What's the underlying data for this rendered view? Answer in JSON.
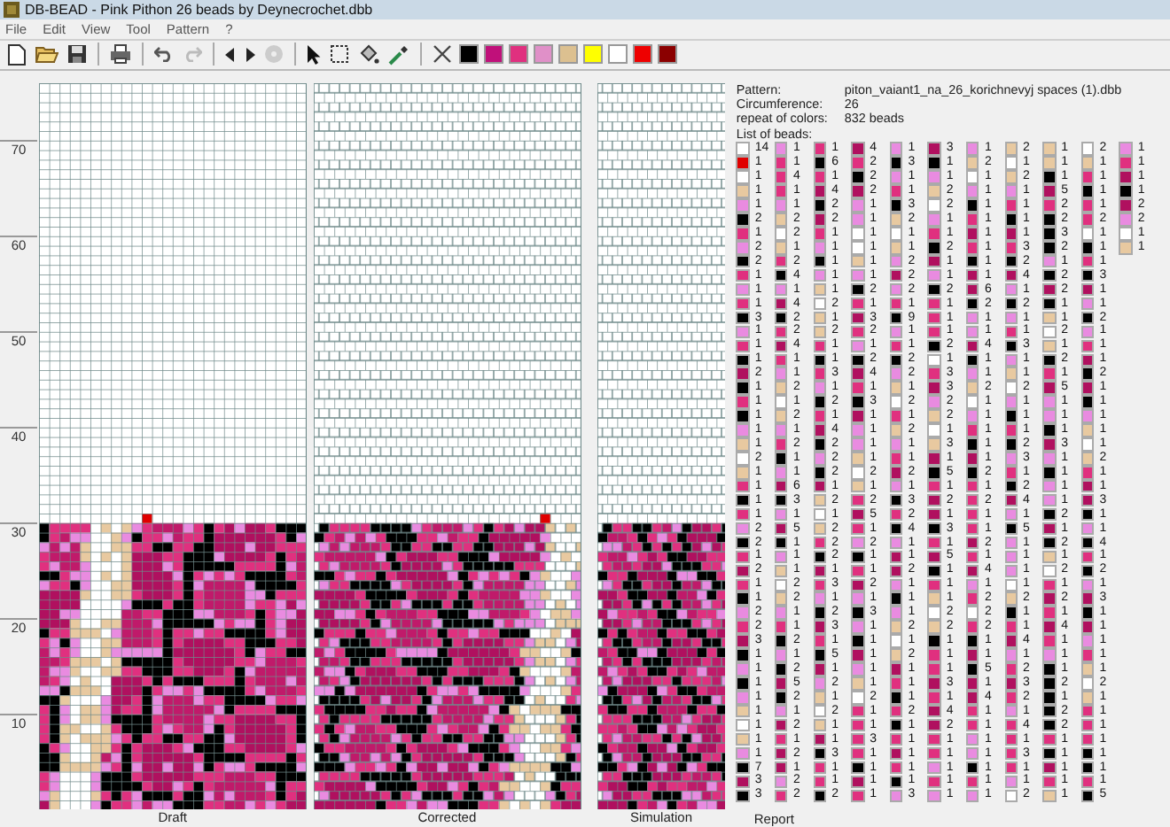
{
  "window": {
    "title": "DB-BEAD - Pink Pithon 26 beads by Deynecrochet.dbb"
  },
  "menu": [
    {
      "label": "File"
    },
    {
      "label": "Edit"
    },
    {
      "label": "View"
    },
    {
      "label": "Tool"
    },
    {
      "label": "Pattern"
    },
    {
      "label": "?"
    }
  ],
  "palette": [
    {
      "color": "#000000"
    },
    {
      "color": "#c0107a"
    },
    {
      "color": "#e0307f"
    },
    {
      "color": "#e090c8"
    },
    {
      "color": "#dcc090"
    },
    {
      "color": "#ffff00"
    },
    {
      "color": "#ffffff"
    },
    {
      "color": "#ee0000"
    },
    {
      "color": "#8b0000"
    }
  ],
  "ruler": [
    "70",
    "60",
    "50",
    "40",
    "30",
    "20",
    "10"
  ],
  "panels": [
    {
      "label": "Draft",
      "kind": "draft"
    },
    {
      "label": "Corrected",
      "kind": "corrected"
    },
    {
      "label": "Simulation",
      "kind": "simulation"
    }
  ],
  "report": {
    "label": "Report",
    "fields": [
      {
        "label": "Pattern:",
        "value": "piton_vaiant1_na_26_korichnevyj spaces (1).dbb"
      },
      {
        "label": "Circumference:",
        "value": "26"
      },
      {
        "label": "repeat of colors:",
        "value": "832 beads"
      }
    ],
    "list_title": "List of beads:",
    "rows": [
      [
        {
          "color": "#ffffff",
          "count": "14"
        },
        {
          "color": "#e98be0",
          "count": "1"
        },
        {
          "color": "#e0307f",
          "count": "1"
        },
        {
          "color": "#b0105f",
          "count": "4"
        },
        {
          "color": "#e98be0",
          "count": "1"
        },
        {
          "color": "#b0105f",
          "count": "3"
        },
        {
          "color": "#e98be0",
          "count": "1"
        },
        {
          "color": "#e8c9a0",
          "count": "2"
        },
        {
          "color": "#e8c9a0",
          "count": "1"
        },
        {
          "color": "#ffffff",
          "count": "2"
        },
        {
          "color": "#e98be0",
          "count": "1"
        }
      ],
      [
        {
          "color": "#e00000",
          "count": "1"
        },
        {
          "color": "#e0307f",
          "count": "1"
        },
        {
          "color": "#000000",
          "count": "6"
        },
        {
          "color": "#e0307f",
          "count": "2"
        },
        {
          "color": "#000000",
          "count": "3"
        },
        {
          "color": "#000000",
          "count": "1"
        },
        {
          "color": "#e8c9a0",
          "count": "2"
        },
        {
          "color": "#ffffff",
          "count": "1"
        },
        {
          "color": "#e8c9a0",
          "count": "1"
        },
        {
          "color": "#e8c9a0",
          "count": "1"
        },
        {
          "color": "#e0307f",
          "count": "1"
        }
      ],
      [
        {
          "color": "#ffffff",
          "count": "1"
        },
        {
          "color": "#e0307f",
          "count": "4"
        },
        {
          "color": "#e0307f",
          "count": "1"
        },
        {
          "color": "#000000",
          "count": "2"
        },
        {
          "color": "#e98be0",
          "count": "1"
        },
        {
          "color": "#e98be0",
          "count": "1"
        },
        {
          "color": "#ffffff",
          "count": "1"
        },
        {
          "color": "#e8c9a0",
          "count": "2"
        },
        {
          "color": "#000000",
          "count": "1"
        },
        {
          "color": "#e0307f",
          "count": "1"
        },
        {
          "color": "#b0105f",
          "count": "1"
        }
      ],
      [
        {
          "color": "#e8c9a0",
          "count": "1"
        },
        {
          "color": "#e0307f",
          "count": "1"
        },
        {
          "color": "#b0105f",
          "count": "4"
        },
        {
          "color": "#b0105f",
          "count": "2"
        },
        {
          "color": "#e0307f",
          "count": "1"
        },
        {
          "color": "#e8c9a0",
          "count": "2"
        },
        {
          "color": "#e98be0",
          "count": "1"
        },
        {
          "color": "#e98be0",
          "count": "1"
        },
        {
          "color": "#b0105f",
          "count": "5"
        },
        {
          "color": "#000000",
          "count": "1"
        },
        {
          "color": "#000000",
          "count": "1"
        }
      ],
      [
        {
          "color": "#e98be0",
          "count": "1"
        },
        {
          "color": "#e98be0",
          "count": "1"
        },
        {
          "color": "#000000",
          "count": "2"
        },
        {
          "color": "#e98be0",
          "count": "1"
        },
        {
          "color": "#000000",
          "count": "3"
        },
        {
          "color": "#ffffff",
          "count": "2"
        },
        {
          "color": "#000000",
          "count": "1"
        },
        {
          "color": "#e0307f",
          "count": "1"
        },
        {
          "color": "#e0307f",
          "count": "2"
        },
        {
          "color": "#e0307f",
          "count": "1"
        },
        {
          "color": "#b0105f",
          "count": "2"
        }
      ],
      [
        {
          "color": "#000000",
          "count": "2"
        },
        {
          "color": "#e8c9a0",
          "count": "2"
        },
        {
          "color": "#b0105f",
          "count": "2"
        },
        {
          "color": "#e98be0",
          "count": "1"
        },
        {
          "color": "#e8c9a0",
          "count": "2"
        },
        {
          "color": "#e98be0",
          "count": "1"
        },
        {
          "color": "#e0307f",
          "count": "1"
        },
        {
          "color": "#000000",
          "count": "1"
        },
        {
          "color": "#000000",
          "count": "2"
        },
        {
          "color": "#e0307f",
          "count": "2"
        },
        {
          "color": "#e98be0",
          "count": "2"
        }
      ],
      [
        {
          "color": "#e0307f",
          "count": "1"
        },
        {
          "color": "#ffffff",
          "count": "2"
        },
        {
          "color": "#e0307f",
          "count": "1"
        },
        {
          "color": "#ffffff",
          "count": "1"
        },
        {
          "color": "#ffffff",
          "count": "1"
        },
        {
          "color": "#e0307f",
          "count": "1"
        },
        {
          "color": "#b0105f",
          "count": "1"
        },
        {
          "color": "#b0105f",
          "count": "1"
        },
        {
          "color": "#000000",
          "count": "3"
        },
        {
          "color": "#ffffff",
          "count": "1"
        },
        {
          "color": "#ffffff",
          "count": "1"
        }
      ],
      [
        {
          "color": "#e98be0",
          "count": "2"
        },
        {
          "color": "#e8c9a0",
          "count": "1"
        },
        {
          "color": "#e98be0",
          "count": "1"
        },
        {
          "color": "#ffffff",
          "count": "1"
        },
        {
          "color": "#e8c9a0",
          "count": "1"
        },
        {
          "color": "#000000",
          "count": "2"
        },
        {
          "color": "#e0307f",
          "count": "1"
        },
        {
          "color": "#e0307f",
          "count": "3"
        },
        {
          "color": "#000000",
          "count": "2"
        },
        {
          "color": "#000000",
          "count": "1"
        },
        {
          "color": "#e8c9a0",
          "count": "1"
        }
      ],
      [
        {
          "color": "#000000",
          "count": "2"
        },
        {
          "color": "#e0307f",
          "count": "2"
        },
        {
          "color": "#000000",
          "count": "1"
        },
        {
          "color": "#e8c9a0",
          "count": "1"
        },
        {
          "color": "#e98be0",
          "count": "2"
        },
        {
          "color": "#b0105f",
          "count": "1"
        },
        {
          "color": "#000000",
          "count": "1"
        },
        {
          "color": "#000000",
          "count": "2"
        },
        {
          "color": "#e98be0",
          "count": "1"
        },
        {
          "color": "#e0307f",
          "count": "1"
        }
      ],
      [
        {
          "color": "#e0307f",
          "count": "1"
        },
        {
          "color": "#000000",
          "count": "4"
        },
        {
          "color": "#e98be0",
          "count": "1"
        },
        {
          "color": "#e98be0",
          "count": "1"
        },
        {
          "color": "#b0105f",
          "count": "2"
        },
        {
          "color": "#e98be0",
          "count": "1"
        },
        {
          "color": "#b0105f",
          "count": "1"
        },
        {
          "color": "#b0105f",
          "count": "4"
        },
        {
          "color": "#000000",
          "count": "2"
        },
        {
          "color": "#000000",
          "count": "3"
        }
      ],
      [
        {
          "color": "#e98be0",
          "count": "1"
        },
        {
          "color": "#e98be0",
          "count": "1"
        },
        {
          "color": "#e8c9a0",
          "count": "1"
        },
        {
          "color": "#000000",
          "count": "2"
        },
        {
          "color": "#e98be0",
          "count": "2"
        },
        {
          "color": "#000000",
          "count": "2"
        },
        {
          "color": "#b0105f",
          "count": "6"
        },
        {
          "color": "#e98be0",
          "count": "1"
        },
        {
          "color": "#b0105f",
          "count": "2"
        },
        {
          "color": "#b0105f",
          "count": "1"
        }
      ],
      [
        {
          "color": "#e0307f",
          "count": "1"
        },
        {
          "color": "#b0105f",
          "count": "4"
        },
        {
          "color": "#ffffff",
          "count": "2"
        },
        {
          "color": "#e0307f",
          "count": "1"
        },
        {
          "color": "#e0307f",
          "count": "1"
        },
        {
          "color": "#e0307f",
          "count": "1"
        },
        {
          "color": "#000000",
          "count": "2"
        },
        {
          "color": "#000000",
          "count": "2"
        },
        {
          "color": "#000000",
          "count": "1"
        },
        {
          "color": "#e98be0",
          "count": "1"
        }
      ],
      [
        {
          "color": "#000000",
          "count": "3"
        },
        {
          "color": "#000000",
          "count": "2"
        },
        {
          "color": "#e8c9a0",
          "count": "1"
        },
        {
          "color": "#b0105f",
          "count": "3"
        },
        {
          "color": "#000000",
          "count": "9"
        },
        {
          "color": "#e0307f",
          "count": "1"
        },
        {
          "color": "#e98be0",
          "count": "1"
        },
        {
          "color": "#e98be0",
          "count": "1"
        },
        {
          "color": "#e8c9a0",
          "count": "1"
        },
        {
          "color": "#000000",
          "count": "2"
        }
      ],
      [
        {
          "color": "#e98be0",
          "count": "1"
        },
        {
          "color": "#e0307f",
          "count": "2"
        },
        {
          "color": "#e8c9a0",
          "count": "2"
        },
        {
          "color": "#e0307f",
          "count": "2"
        },
        {
          "color": "#e98be0",
          "count": "1"
        },
        {
          "color": "#e0307f",
          "count": "1"
        },
        {
          "color": "#e98be0",
          "count": "1"
        },
        {
          "color": "#e0307f",
          "count": "1"
        },
        {
          "color": "#ffffff",
          "count": "2"
        },
        {
          "color": "#e98be0",
          "count": "1"
        }
      ],
      [
        {
          "color": "#e0307f",
          "count": "1"
        },
        {
          "color": "#b0105f",
          "count": "4"
        },
        {
          "color": "#e0307f",
          "count": "1"
        },
        {
          "color": "#e98be0",
          "count": "1"
        },
        {
          "color": "#e0307f",
          "count": "1"
        },
        {
          "color": "#000000",
          "count": "2"
        },
        {
          "color": "#b0105f",
          "count": "4"
        },
        {
          "color": "#000000",
          "count": "3"
        },
        {
          "color": "#e8c9a0",
          "count": "1"
        },
        {
          "color": "#e0307f",
          "count": "1"
        }
      ],
      [
        {
          "color": "#000000",
          "count": "1"
        },
        {
          "color": "#e0307f",
          "count": "1"
        },
        {
          "color": "#000000",
          "count": "1"
        },
        {
          "color": "#000000",
          "count": "2"
        },
        {
          "color": "#000000",
          "count": "2"
        },
        {
          "color": "#ffffff",
          "count": "1"
        },
        {
          "color": "#000000",
          "count": "1"
        },
        {
          "color": "#e98be0",
          "count": "1"
        },
        {
          "color": "#000000",
          "count": "2"
        },
        {
          "color": "#b0105f",
          "count": "1"
        }
      ],
      [
        {
          "color": "#b0105f",
          "count": "2"
        },
        {
          "color": "#e98be0",
          "count": "1"
        },
        {
          "color": "#e0307f",
          "count": "3"
        },
        {
          "color": "#b0105f",
          "count": "4"
        },
        {
          "color": "#e98be0",
          "count": "2"
        },
        {
          "color": "#e0307f",
          "count": "3"
        },
        {
          "color": "#e98be0",
          "count": "1"
        },
        {
          "color": "#e8c9a0",
          "count": "1"
        },
        {
          "color": "#e0307f",
          "count": "1"
        },
        {
          "color": "#000000",
          "count": "2"
        }
      ],
      [
        {
          "color": "#000000",
          "count": "1"
        },
        {
          "color": "#e8c9a0",
          "count": "2"
        },
        {
          "color": "#e98be0",
          "count": "1"
        },
        {
          "color": "#e0307f",
          "count": "1"
        },
        {
          "color": "#e8c9a0",
          "count": "1"
        },
        {
          "color": "#b0105f",
          "count": "3"
        },
        {
          "color": "#e8c9a0",
          "count": "2"
        },
        {
          "color": "#ffffff",
          "count": "2"
        },
        {
          "color": "#b0105f",
          "count": "5"
        },
        {
          "color": "#b0105f",
          "count": "1"
        }
      ],
      [
        {
          "color": "#e0307f",
          "count": "1"
        },
        {
          "color": "#ffffff",
          "count": "1"
        },
        {
          "color": "#000000",
          "count": "2"
        },
        {
          "color": "#000000",
          "count": "3"
        },
        {
          "color": "#ffffff",
          "count": "2"
        },
        {
          "color": "#e98be0",
          "count": "2"
        },
        {
          "color": "#ffffff",
          "count": "1"
        },
        {
          "color": "#e98be0",
          "count": "1"
        },
        {
          "color": "#e98be0",
          "count": "1"
        },
        {
          "color": "#000000",
          "count": "1"
        }
      ],
      [
        {
          "color": "#000000",
          "count": "1"
        },
        {
          "color": "#e8c9a0",
          "count": "2"
        },
        {
          "color": "#e0307f",
          "count": "1"
        },
        {
          "color": "#b0105f",
          "count": "1"
        },
        {
          "color": "#e0307f",
          "count": "1"
        },
        {
          "color": "#e8c9a0",
          "count": "2"
        },
        {
          "color": "#e98be0",
          "count": "1"
        },
        {
          "color": "#000000",
          "count": "1"
        },
        {
          "color": "#e98be0",
          "count": "1"
        },
        {
          "color": "#e98be0",
          "count": "1"
        }
      ],
      [
        {
          "color": "#e98be0",
          "count": "1"
        },
        {
          "color": "#e98be0",
          "count": "1"
        },
        {
          "color": "#b0105f",
          "count": "4"
        },
        {
          "color": "#e98be0",
          "count": "1"
        },
        {
          "color": "#e8c9a0",
          "count": "2"
        },
        {
          "color": "#ffffff",
          "count": "1"
        },
        {
          "color": "#e0307f",
          "count": "1"
        },
        {
          "color": "#e0307f",
          "count": "1"
        },
        {
          "color": "#000000",
          "count": "1"
        },
        {
          "color": "#e8c9a0",
          "count": "1"
        }
      ],
      [
        {
          "color": "#e8c9a0",
          "count": "1"
        },
        {
          "color": "#e0307f",
          "count": "2"
        },
        {
          "color": "#000000",
          "count": "2"
        },
        {
          "color": "#e98be0",
          "count": "1"
        },
        {
          "color": "#e98be0",
          "count": "1"
        },
        {
          "color": "#e8c9a0",
          "count": "3"
        },
        {
          "color": "#000000",
          "count": "1"
        },
        {
          "color": "#000000",
          "count": "2"
        },
        {
          "color": "#b0105f",
          "count": "3"
        },
        {
          "color": "#ffffff",
          "count": "1"
        }
      ],
      [
        {
          "color": "#ffffff",
          "count": "2"
        },
        {
          "color": "#000000",
          "count": "1"
        },
        {
          "color": "#e98be0",
          "count": "2"
        },
        {
          "color": "#e8c9a0",
          "count": "1"
        },
        {
          "color": "#e0307f",
          "count": "1"
        },
        {
          "color": "#b0105f",
          "count": "1"
        },
        {
          "color": "#b0105f",
          "count": "1"
        },
        {
          "color": "#e98be0",
          "count": "3"
        },
        {
          "color": "#e98be0",
          "count": "1"
        },
        {
          "color": "#e8c9a0",
          "count": "2"
        }
      ],
      [
        {
          "color": "#e8c9a0",
          "count": "1"
        },
        {
          "color": "#e98be0",
          "count": "1"
        },
        {
          "color": "#000000",
          "count": "2"
        },
        {
          "color": "#ffffff",
          "count": "2"
        },
        {
          "color": "#b0105f",
          "count": "2"
        },
        {
          "color": "#000000",
          "count": "5"
        },
        {
          "color": "#000000",
          "count": "2"
        },
        {
          "color": "#e0307f",
          "count": "1"
        },
        {
          "color": "#000000",
          "count": "1"
        },
        {
          "color": "#e0307f",
          "count": "1"
        }
      ],
      [
        {
          "color": "#e0307f",
          "count": "1"
        },
        {
          "color": "#b0105f",
          "count": "6"
        },
        {
          "color": "#b0105f",
          "count": "1"
        },
        {
          "color": "#e8c9a0",
          "count": "1"
        },
        {
          "color": "#e98be0",
          "count": "1"
        },
        {
          "color": "#e0307f",
          "count": "1"
        },
        {
          "color": "#e0307f",
          "count": "1"
        },
        {
          "color": "#000000",
          "count": "2"
        },
        {
          "color": "#e98be0",
          "count": "1"
        },
        {
          "color": "#b0105f",
          "count": "1"
        }
      ],
      [
        {
          "color": "#000000",
          "count": "1"
        },
        {
          "color": "#000000",
          "count": "3"
        },
        {
          "color": "#e8c9a0",
          "count": "2"
        },
        {
          "color": "#e0307f",
          "count": "2"
        },
        {
          "color": "#000000",
          "count": "3"
        },
        {
          "color": "#b0105f",
          "count": "2"
        },
        {
          "color": "#e0307f",
          "count": "2"
        },
        {
          "color": "#b0105f",
          "count": "4"
        },
        {
          "color": "#e98be0",
          "count": "1"
        },
        {
          "color": "#b0105f",
          "count": "3"
        }
      ],
      [
        {
          "color": "#e0307f",
          "count": "1"
        },
        {
          "color": "#e98be0",
          "count": "1"
        },
        {
          "color": "#ffffff",
          "count": "1"
        },
        {
          "color": "#b0105f",
          "count": "5"
        },
        {
          "color": "#e0307f",
          "count": "2"
        },
        {
          "color": "#b0105f",
          "count": "1"
        },
        {
          "color": "#e0307f",
          "count": "1"
        },
        {
          "color": "#e98be0",
          "count": "1"
        },
        {
          "color": "#000000",
          "count": "2"
        },
        {
          "color": "#000000",
          "count": "1"
        }
      ],
      [
        {
          "color": "#e98be0",
          "count": "2"
        },
        {
          "color": "#b0105f",
          "count": "5"
        },
        {
          "color": "#e8c9a0",
          "count": "2"
        },
        {
          "color": "#e0307f",
          "count": "1"
        },
        {
          "color": "#000000",
          "count": "4"
        },
        {
          "color": "#000000",
          "count": "3"
        },
        {
          "color": "#e0307f",
          "count": "1"
        },
        {
          "color": "#000000",
          "count": "5"
        },
        {
          "color": "#b0105f",
          "count": "1"
        },
        {
          "color": "#e98be0",
          "count": "1"
        }
      ],
      [
        {
          "color": "#000000",
          "count": "2"
        },
        {
          "color": "#000000",
          "count": "1"
        },
        {
          "color": "#e0307f",
          "count": "2"
        },
        {
          "color": "#e98be0",
          "count": "2"
        },
        {
          "color": "#e98be0",
          "count": "1"
        },
        {
          "color": "#e0307f",
          "count": "1"
        },
        {
          "color": "#b0105f",
          "count": "2"
        },
        {
          "color": "#e98be0",
          "count": "1"
        },
        {
          "color": "#000000",
          "count": "2"
        },
        {
          "color": "#000000",
          "count": "4"
        }
      ],
      [
        {
          "color": "#e0307f",
          "count": "1"
        },
        {
          "color": "#e98be0",
          "count": "1"
        },
        {
          "color": "#000000",
          "count": "2"
        },
        {
          "color": "#000000",
          "count": "1"
        },
        {
          "color": "#b0105f",
          "count": "1"
        },
        {
          "color": "#b0105f",
          "count": "5"
        },
        {
          "color": "#e0307f",
          "count": "1"
        },
        {
          "color": "#e98be0",
          "count": "1"
        },
        {
          "color": "#e8c9a0",
          "count": "1"
        },
        {
          "color": "#e0307f",
          "count": "1"
        }
      ],
      [
        {
          "color": "#b0105f",
          "count": "2"
        },
        {
          "color": "#e8c9a0",
          "count": "1"
        },
        {
          "color": "#b0105f",
          "count": "1"
        },
        {
          "color": "#e0307f",
          "count": "1"
        },
        {
          "color": "#b0105f",
          "count": "2"
        },
        {
          "color": "#000000",
          "count": "1"
        },
        {
          "color": "#b0105f",
          "count": "4"
        },
        {
          "color": "#e98be0",
          "count": "1"
        },
        {
          "color": "#ffffff",
          "count": "2"
        },
        {
          "color": "#000000",
          "count": "2"
        }
      ],
      [
        {
          "color": "#e0307f",
          "count": "1"
        },
        {
          "color": "#ffffff",
          "count": "2"
        },
        {
          "color": "#e0307f",
          "count": "3"
        },
        {
          "color": "#b0105f",
          "count": "2"
        },
        {
          "color": "#e98be0",
          "count": "1"
        },
        {
          "color": "#e0307f",
          "count": "1"
        },
        {
          "color": "#e98be0",
          "count": "1"
        },
        {
          "color": "#ffffff",
          "count": "1"
        },
        {
          "color": "#e0307f",
          "count": "1"
        },
        {
          "color": "#e98be0",
          "count": "1"
        }
      ],
      [
        {
          "color": "#000000",
          "count": "1"
        },
        {
          "color": "#e8c9a0",
          "count": "2"
        },
        {
          "color": "#e98be0",
          "count": "1"
        },
        {
          "color": "#e98be0",
          "count": "1"
        },
        {
          "color": "#000000",
          "count": "1"
        },
        {
          "color": "#e8c9a0",
          "count": "1"
        },
        {
          "color": "#e0307f",
          "count": "2"
        },
        {
          "color": "#e8c9a0",
          "count": "2"
        },
        {
          "color": "#b0105f",
          "count": "2"
        },
        {
          "color": "#b0105f",
          "count": "3"
        }
      ],
      [
        {
          "color": "#e98be0",
          "count": "2"
        },
        {
          "color": "#e98be0",
          "count": "1"
        },
        {
          "color": "#000000",
          "count": "2"
        },
        {
          "color": "#000000",
          "count": "3"
        },
        {
          "color": "#e98be0",
          "count": "1"
        },
        {
          "color": "#ffffff",
          "count": "2"
        },
        {
          "color": "#ffffff",
          "count": "2"
        },
        {
          "color": "#000000",
          "count": "1"
        },
        {
          "color": "#e0307f",
          "count": "1"
        },
        {
          "color": "#000000",
          "count": "1"
        }
      ],
      [
        {
          "color": "#e0307f",
          "count": "2"
        },
        {
          "color": "#e0307f",
          "count": "1"
        },
        {
          "color": "#b0105f",
          "count": "3"
        },
        {
          "color": "#e98be0",
          "count": "1"
        },
        {
          "color": "#e8c9a0",
          "count": "2"
        },
        {
          "color": "#e8c9a0",
          "count": "2"
        },
        {
          "color": "#e0307f",
          "count": "2"
        },
        {
          "color": "#e0307f",
          "count": "1"
        },
        {
          "color": "#b0105f",
          "count": "4"
        },
        {
          "color": "#b0105f",
          "count": "1"
        }
      ],
      [
        {
          "color": "#b0105f",
          "count": "3"
        },
        {
          "color": "#000000",
          "count": "2"
        },
        {
          "color": "#e0307f",
          "count": "1"
        },
        {
          "color": "#000000",
          "count": "1"
        },
        {
          "color": "#ffffff",
          "count": "1"
        },
        {
          "color": "#000000",
          "count": "1"
        },
        {
          "color": "#000000",
          "count": "1"
        },
        {
          "color": "#b0105f",
          "count": "4"
        },
        {
          "color": "#e0307f",
          "count": "1"
        },
        {
          "color": "#e98be0",
          "count": "1"
        }
      ],
      [
        {
          "color": "#000000",
          "count": "1"
        },
        {
          "color": "#e98be0",
          "count": "1"
        },
        {
          "color": "#000000",
          "count": "5"
        },
        {
          "color": "#b0105f",
          "count": "1"
        },
        {
          "color": "#e8c9a0",
          "count": "2"
        },
        {
          "color": "#e0307f",
          "count": "1"
        },
        {
          "color": "#b0105f",
          "count": "1"
        },
        {
          "color": "#e98be0",
          "count": "1"
        },
        {
          "color": "#e98be0",
          "count": "1"
        },
        {
          "color": "#e0307f",
          "count": "1"
        }
      ],
      [
        {
          "color": "#e98be0",
          "count": "1"
        },
        {
          "color": "#000000",
          "count": "2"
        },
        {
          "color": "#b0105f",
          "count": "1"
        },
        {
          "color": "#e98be0",
          "count": "1"
        },
        {
          "color": "#b0105f",
          "count": "1"
        },
        {
          "color": "#e0307f",
          "count": "1"
        },
        {
          "color": "#000000",
          "count": "5"
        },
        {
          "color": "#e0307f",
          "count": "2"
        },
        {
          "color": "#000000",
          "count": "1"
        },
        {
          "color": "#e8c9a0",
          "count": "1"
        }
      ],
      [
        {
          "color": "#000000",
          "count": "1"
        },
        {
          "color": "#b0105f",
          "count": "5"
        },
        {
          "color": "#e98be0",
          "count": "2"
        },
        {
          "color": "#e8c9a0",
          "count": "1"
        },
        {
          "color": "#e0307f",
          "count": "1"
        },
        {
          "color": "#b0105f",
          "count": "3"
        },
        {
          "color": "#b0105f",
          "count": "1"
        },
        {
          "color": "#b0105f",
          "count": "3"
        },
        {
          "color": "#000000",
          "count": "2"
        },
        {
          "color": "#ffffff",
          "count": "2"
        }
      ],
      [
        {
          "color": "#e98be0",
          "count": "1"
        },
        {
          "color": "#000000",
          "count": "2"
        },
        {
          "color": "#e8c9a0",
          "count": "1"
        },
        {
          "color": "#ffffff",
          "count": "2"
        },
        {
          "color": "#000000",
          "count": "1"
        },
        {
          "color": "#e0307f",
          "count": "1"
        },
        {
          "color": "#b0105f",
          "count": "4"
        },
        {
          "color": "#e0307f",
          "count": "2"
        },
        {
          "color": "#000000",
          "count": "1"
        },
        {
          "color": "#e8c9a0",
          "count": "1"
        }
      ],
      [
        {
          "color": "#e8c9a0",
          "count": "1"
        },
        {
          "color": "#e98be0",
          "count": "1"
        },
        {
          "color": "#ffffff",
          "count": "2"
        },
        {
          "color": "#e0307f",
          "count": "1"
        },
        {
          "color": "#e0307f",
          "count": "2"
        },
        {
          "color": "#b0105f",
          "count": "4"
        },
        {
          "color": "#e0307f",
          "count": "1"
        },
        {
          "color": "#e98be0",
          "count": "1"
        },
        {
          "color": "#000000",
          "count": "2"
        },
        {
          "color": "#e0307f",
          "count": "1"
        }
      ],
      [
        {
          "color": "#ffffff",
          "count": "1"
        },
        {
          "color": "#b0105f",
          "count": "2"
        },
        {
          "color": "#e8c9a0",
          "count": "1"
        },
        {
          "color": "#e0307f",
          "count": "1"
        },
        {
          "color": "#000000",
          "count": "1"
        },
        {
          "color": "#b0105f",
          "count": "2"
        },
        {
          "color": "#e0307f",
          "count": "1"
        },
        {
          "color": "#e0307f",
          "count": "4"
        },
        {
          "color": "#000000",
          "count": "2"
        },
        {
          "color": "#e0307f",
          "count": "1"
        }
      ],
      [
        {
          "color": "#e8c9a0",
          "count": "1"
        },
        {
          "color": "#e0307f",
          "count": "1"
        },
        {
          "color": "#b0105f",
          "count": "1"
        },
        {
          "color": "#e0307f",
          "count": "3"
        },
        {
          "color": "#e0307f",
          "count": "1"
        },
        {
          "color": "#e0307f",
          "count": "1"
        },
        {
          "color": "#e98be0",
          "count": "1"
        },
        {
          "color": "#e0307f",
          "count": "1"
        },
        {
          "color": "#e0307f",
          "count": "1"
        },
        {
          "color": "#e0307f",
          "count": "1"
        }
      ],
      [
        {
          "color": "#e98be0",
          "count": "1"
        },
        {
          "color": "#b0105f",
          "count": "2"
        },
        {
          "color": "#000000",
          "count": "3"
        },
        {
          "color": "#e0307f",
          "count": "1"
        },
        {
          "color": "#b0105f",
          "count": "1"
        },
        {
          "color": "#e0307f",
          "count": "1"
        },
        {
          "color": "#e98be0",
          "count": "1"
        },
        {
          "color": "#e0307f",
          "count": "3"
        },
        {
          "color": "#000000",
          "count": "1"
        },
        {
          "color": "#000000",
          "count": "1"
        }
      ],
      [
        {
          "color": "#000000",
          "count": "7"
        },
        {
          "color": "#b0105f",
          "count": "1"
        },
        {
          "color": "#e0307f",
          "count": "1"
        },
        {
          "color": "#000000",
          "count": "1"
        },
        {
          "color": "#e0307f",
          "count": "1"
        },
        {
          "color": "#e98be0",
          "count": "1"
        },
        {
          "color": "#000000",
          "count": "1"
        },
        {
          "color": "#e0307f",
          "count": "1"
        },
        {
          "color": "#b0105f",
          "count": "1"
        },
        {
          "color": "#000000",
          "count": "1"
        }
      ],
      [
        {
          "color": "#b0105f",
          "count": "3"
        },
        {
          "color": "#e98be0",
          "count": "2"
        },
        {
          "color": "#e0307f",
          "count": "1"
        },
        {
          "color": "#b0105f",
          "count": "1"
        },
        {
          "color": "#000000",
          "count": "1"
        },
        {
          "color": "#e0307f",
          "count": "1"
        },
        {
          "color": "#e0307f",
          "count": "1"
        },
        {
          "color": "#e98be0",
          "count": "1"
        },
        {
          "color": "#e0307f",
          "count": "1"
        },
        {
          "color": "#e0307f",
          "count": "1"
        }
      ],
      [
        {
          "color": "#000000",
          "count": "3"
        },
        {
          "color": "#e0307f",
          "count": "2"
        },
        {
          "color": "#000000",
          "count": "2"
        },
        {
          "color": "#e0307f",
          "count": "1"
        },
        {
          "color": "#e98be0",
          "count": "3"
        },
        {
          "color": "#e98be0",
          "count": "1"
        },
        {
          "color": "#e98be0",
          "count": "1"
        },
        {
          "color": "#ffffff",
          "count": "2"
        },
        {
          "color": "#e8c9a0",
          "count": "1"
        },
        {
          "color": "#000000",
          "count": "5"
        }
      ]
    ]
  }
}
